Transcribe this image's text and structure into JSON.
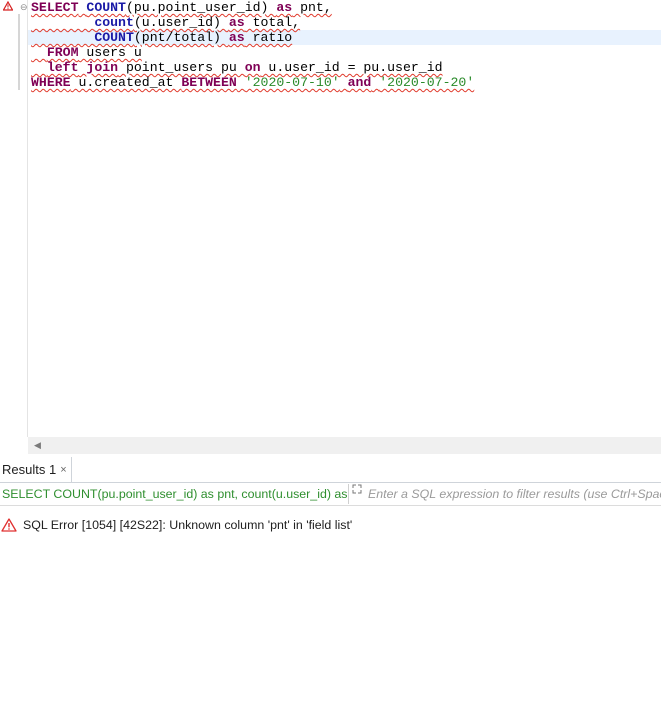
{
  "editor": {
    "lines": [
      [
        {
          "t": "SELECT",
          "c": "kw"
        },
        {
          "t": " ",
          "c": "id"
        },
        {
          "t": "COUNT",
          "c": "fn"
        },
        {
          "t": "(pu.point_user_id) ",
          "c": "id"
        },
        {
          "t": "as",
          "c": "kw"
        },
        {
          "t": " pnt,",
          "c": "id"
        }
      ],
      [
        {
          "t": "        ",
          "c": "id"
        },
        {
          "t": "count",
          "c": "fn"
        },
        {
          "t": "(u.user_id) ",
          "c": "id"
        },
        {
          "t": "as",
          "c": "kw"
        },
        {
          "t": " total,",
          "c": "id"
        }
      ],
      [
        {
          "t": "        ",
          "c": "id"
        },
        {
          "t": "COUNT",
          "c": "fn"
        },
        {
          "t": "(pnt/total) ",
          "c": "id"
        },
        {
          "t": "as",
          "c": "kw"
        },
        {
          "t": " ratio",
          "c": "id"
        }
      ],
      [
        {
          "t": "  ",
          "c": "id"
        },
        {
          "t": "FROM",
          "c": "kw"
        },
        {
          "t": " users u",
          "c": "id"
        }
      ],
      [
        {
          "t": "  ",
          "c": "id"
        },
        {
          "t": "left",
          "c": "kw"
        },
        {
          "t": " ",
          "c": "id"
        },
        {
          "t": "join",
          "c": "kw"
        },
        {
          "t": " point_users pu ",
          "c": "id"
        },
        {
          "t": "on",
          "c": "kw"
        },
        {
          "t": " u.user_id = pu.user_id",
          "c": "id"
        }
      ],
      [
        {
          "t": "WHERE",
          "c": "kw"
        },
        {
          "t": " u.created_at ",
          "c": "id"
        },
        {
          "t": "BETWEEN",
          "c": "kw"
        },
        {
          "t": " ",
          "c": "id"
        },
        {
          "t": "'2020-07-10'",
          "c": "str"
        },
        {
          "t": " ",
          "c": "id"
        },
        {
          "t": "and",
          "c": "kw"
        },
        {
          "t": " ",
          "c": "id"
        },
        {
          "t": "'2020-07-20'",
          "c": "str"
        }
      ]
    ],
    "current_line_index": 2,
    "warning_icon": "warning-triangle-icon",
    "fold_icon": "fold-collapse-icon"
  },
  "scrollbar": {
    "left_arrow_icon": "scroll-left-arrow-icon"
  },
  "results": {
    "tab_label": "Results 1",
    "tab_close_glyph": "×",
    "query_summary": "SELECT COUNT(pu.point_user_id) as pnt, count(u.user_id) as total, COUNT(pnt/total) as ratio FROM users u left join point_users pu on u.user_id = pu.user_id WHERE u.created_at BETWEEN '2020-07-10' and '2020-07-20'",
    "filter_placeholder": "Enter a SQL expression to filter results (use Ctrl+Space)",
    "expand_icon": "expand-arrows-icon",
    "error_icon": "error-triangle-icon",
    "error_message": "SQL Error [1054] [42S22]: Unknown column 'pnt' in 'field list'"
  },
  "colors": {
    "keyword": "#7f0055",
    "function": "#1a1aa6",
    "string": "#2a8a2a",
    "current_line": "#e8f2fe",
    "error_underline": "#e0392b",
    "query_summary": "#2f8f2f"
  }
}
